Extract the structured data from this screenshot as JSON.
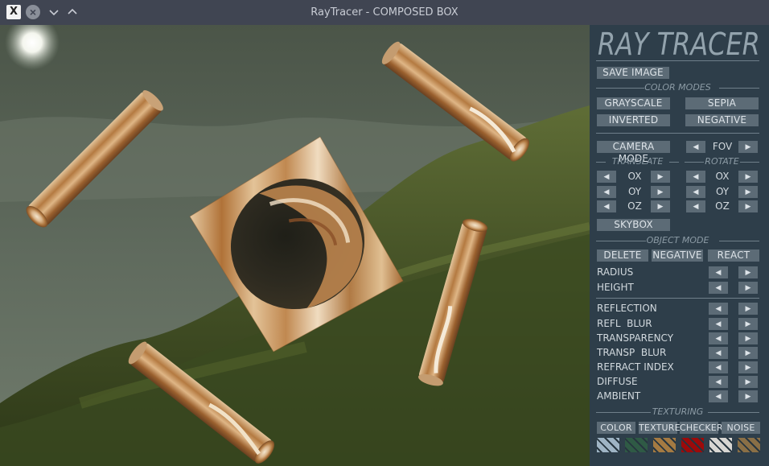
{
  "window": {
    "title": "RayTracer - COMPOSED BOX",
    "app_icon_glyph": "X",
    "close_glyph": "×",
    "minimize_glyph": "∨",
    "maximize_glyph": "∧"
  },
  "panel": {
    "logo": "RAY TRACER",
    "save_image": "SAVE IMAGE",
    "color_modes": {
      "header": "COLOR MODES",
      "grayscale": "GRAYSCALE",
      "sepia": "SEPIA",
      "inverted": "INVERTED",
      "negative": "NEGATIVE"
    },
    "camera": {
      "mode": "CAMERA MODE",
      "fov": "FOV",
      "translate_header": "TRANSLATE",
      "rotate_header": "ROTATE",
      "ox": "OX",
      "oy": "OY",
      "oz": "OZ",
      "skybox": "SKYBOX"
    },
    "object_mode": {
      "header": "OBJECT MODE",
      "delete": "DELETE",
      "negative": "NEGATIVE",
      "react": "REACT",
      "radius": "RADIUS",
      "height": "HEIGHT"
    },
    "material": {
      "reflection": "REFLECTION",
      "refl_blur": "REFL  BLUR",
      "transparency": "TRANSPARENCY",
      "transp_blur": "TRANSP  BLUR",
      "refract_index": "REFRACT INDEX",
      "diffuse": "DIFFUSE",
      "ambient": "AMBIENT"
    },
    "texturing": {
      "header": "TEXTURING",
      "color": "COLOR",
      "texture": "TEXTURE",
      "checker": "CHECKER",
      "noise": "NOISE",
      "swatch_colors": [
        "#9fb4c4",
        "#2f5a45",
        "#a47a42",
        "#9d0a0a",
        "#d8d6d2",
        "#8a6f46"
      ]
    },
    "arrow_left": "◀",
    "arrow_right": "▶"
  },
  "colors": {
    "panel_bg": "#2e3e4a",
    "button_bg": "#5c6b76",
    "titlebar_bg": "#404552"
  }
}
